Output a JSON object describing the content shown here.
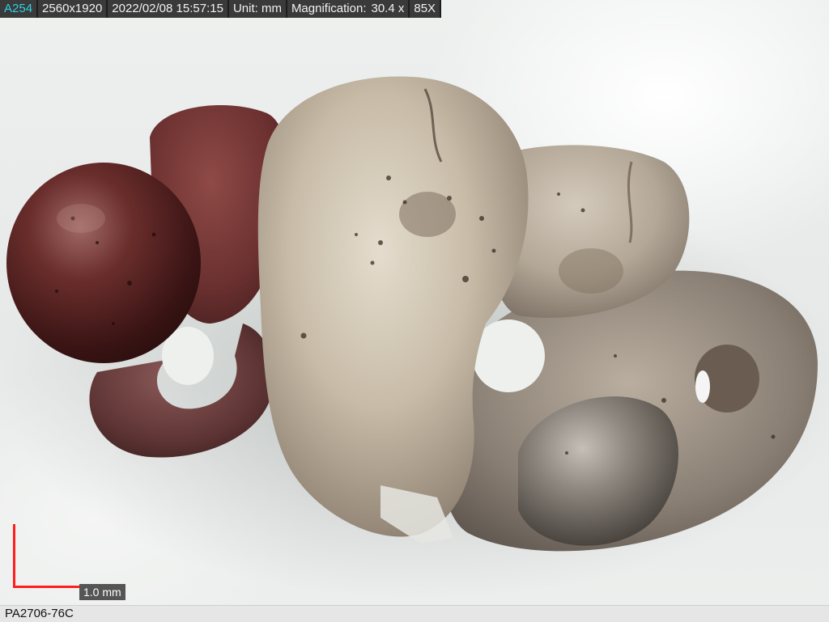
{
  "header": {
    "image_id": "A254",
    "resolution": "2560x1920",
    "timestamp": "2022/02/08 15:57:15",
    "unit_label": "Unit: mm",
    "magnification_label": "Magnification:",
    "magnification_value": "30.4 x",
    "objective": "85X"
  },
  "scale_bar": {
    "label": "1.0 mm"
  },
  "footer": {
    "sample_id": "PA2706-76C"
  },
  "colors": {
    "id_accent": "#2fd0e0",
    "scale_bar": "#ff1f1f",
    "bar_background": "#3a3a3a"
  }
}
